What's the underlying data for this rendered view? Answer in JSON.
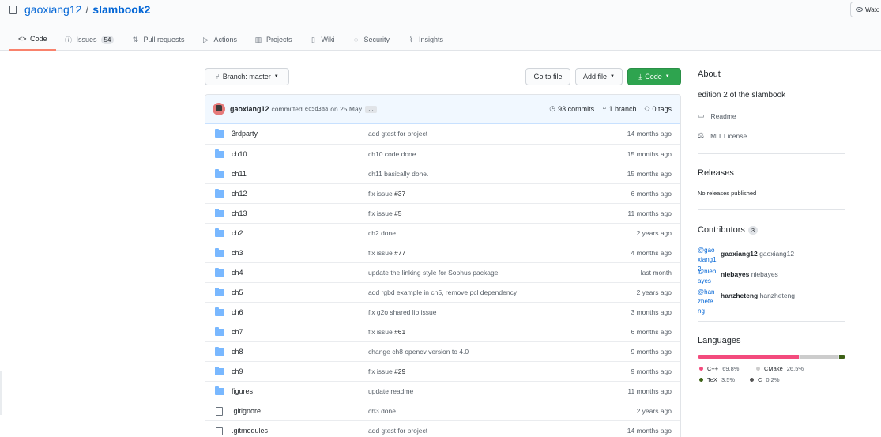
{
  "repo": {
    "owner": "gaoxiang12",
    "separator": "/",
    "name": "slambook2"
  },
  "watch": {
    "label": "Watc"
  },
  "tabs": [
    {
      "label": "Code",
      "icon": "code-icon",
      "glyph": "<>",
      "active": true
    },
    {
      "label": "Issues",
      "icon": "issues-icon",
      "glyph": "ⓘ",
      "counter": "54"
    },
    {
      "label": "Pull requests",
      "icon": "pull-request-icon",
      "glyph": "⇅"
    },
    {
      "label": "Actions",
      "icon": "actions-icon",
      "glyph": "▷"
    },
    {
      "label": "Projects",
      "icon": "projects-icon",
      "glyph": "▥"
    },
    {
      "label": "Wiki",
      "icon": "wiki-icon",
      "glyph": "▯"
    },
    {
      "label": "Security",
      "icon": "security-icon",
      "glyph": "◌"
    },
    {
      "label": "Insights",
      "icon": "insights-icon",
      "glyph": "⌇"
    }
  ],
  "toolbar": {
    "branch_label": "Branch: master",
    "goto_label": "Go to file",
    "add_file_label": "Add file",
    "code_label": "Code"
  },
  "commit": {
    "author": "gaoxiang12",
    "text": "committed",
    "sha": "ec5d3aa",
    "date": "on 25 May",
    "ellipsis": "…",
    "commits": "93 commits",
    "branches": "1 branch",
    "tags": "0 tags"
  },
  "files": [
    {
      "type": "dir",
      "name": "3rdparty",
      "msg": "add gtest for project",
      "age": "14 months ago"
    },
    {
      "type": "dir",
      "name": "ch10",
      "msg": "ch10 code done.",
      "age": "15 months ago"
    },
    {
      "type": "dir",
      "name": "ch11",
      "msg": "ch11 basically done.",
      "age": "15 months ago"
    },
    {
      "type": "dir",
      "name": "ch12",
      "msg": "fix issue ",
      "issue": "#37",
      "age": "6 months ago"
    },
    {
      "type": "dir",
      "name": "ch13",
      "msg": "fix issue ",
      "issue": "#5",
      "age": "11 months ago"
    },
    {
      "type": "dir",
      "name": "ch2",
      "msg": "ch2 done",
      "age": "2 years ago"
    },
    {
      "type": "dir",
      "name": "ch3",
      "msg": "fix issue ",
      "issue": "#77",
      "age": "4 months ago"
    },
    {
      "type": "dir",
      "name": "ch4",
      "msg": "update the linking style for Sophus package",
      "age": "last month"
    },
    {
      "type": "dir",
      "name": "ch5",
      "msg": "add rgbd example in ch5, remove pcl dependency",
      "age": "2 years ago"
    },
    {
      "type": "dir",
      "name": "ch6",
      "msg": "fix g2o shared lib issue",
      "age": "3 months ago"
    },
    {
      "type": "dir",
      "name": "ch7",
      "msg": "fix issue ",
      "issue": "#61",
      "age": "6 months ago"
    },
    {
      "type": "dir",
      "name": "ch8",
      "msg": "change ch8 opencv version to 4.0",
      "age": "9 months ago"
    },
    {
      "type": "dir",
      "name": "ch9",
      "msg": "fix issue ",
      "issue": "#29",
      "age": "9 months ago"
    },
    {
      "type": "dir",
      "name": "figures",
      "msg": "update readme",
      "age": "11 months ago"
    },
    {
      "type": "file",
      "name": ".gitignore",
      "msg": "ch3 done",
      "age": "2 years ago"
    },
    {
      "type": "file",
      "name": ".gitmodules",
      "msg": "add gtest for project",
      "age": "14 months ago"
    }
  ],
  "about": {
    "heading": "About",
    "description": "edition 2 of the slambook",
    "readme": "Readme",
    "license": "MIT License"
  },
  "releases": {
    "heading": "Releases",
    "empty": "No releases published"
  },
  "contributors": {
    "heading": "Contributors",
    "count": "3",
    "people": [
      {
        "handle": "@gaoxiang12",
        "login": "gaoxiang12",
        "name": "gaoxiang12"
      },
      {
        "handle": "@niebayes",
        "login": "niebayes",
        "name": "niebayes"
      },
      {
        "handle": "@hanzheteng",
        "login": "hanzheteng",
        "name": "hanzheteng"
      }
    ]
  },
  "languages": {
    "heading": "Languages",
    "items": [
      {
        "name": "C++",
        "pct": "69.8%",
        "value": 69.8,
        "color": "#f34b7d"
      },
      {
        "name": "CMake",
        "pct": "26.5%",
        "value": 26.5,
        "color": "#cccccc"
      },
      {
        "name": "TeX",
        "pct": "3.5%",
        "value": 3.5,
        "color": "#3d6117"
      },
      {
        "name": "C",
        "pct": "0.2%",
        "value": 0.2,
        "color": "#555555"
      }
    ]
  }
}
